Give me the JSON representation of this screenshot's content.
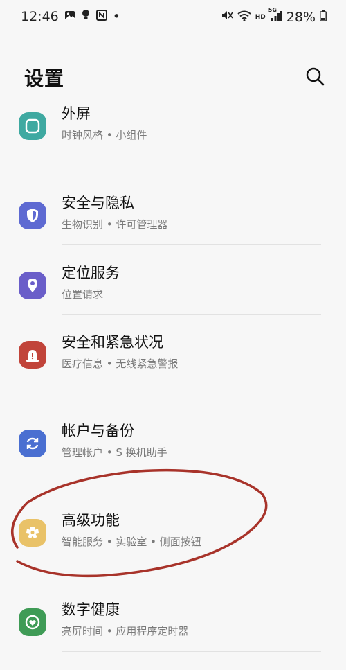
{
  "status_bar": {
    "time": "12:46",
    "dot": "•",
    "network_hd": "HD",
    "network_5g": "5G",
    "battery_percent": "28%"
  },
  "header": {
    "title": "设置"
  },
  "settings_items": [
    {
      "label": "外屏",
      "sub": "时钟风格 • 小组件",
      "icon": "cover-screen-icon",
      "color": "#3fa9a1"
    },
    {
      "label": "安全与隐私",
      "sub": "生物识别 • 许可管理器",
      "icon": "shield-icon",
      "color": "#5e6ad2"
    },
    {
      "label": "定位服务",
      "sub": "位置请求",
      "icon": "location-pin-icon",
      "color": "#6a5ec9"
    },
    {
      "label": "安全和紧急状况",
      "sub": "医疗信息 • 无线紧急警报",
      "icon": "emergency-alert-icon",
      "color": "#c1443a"
    },
    {
      "label": "帐户与备份",
      "sub": "管理帐户 • S 换机助手",
      "icon": "sync-icon",
      "color": "#4a6fd1"
    },
    {
      "label": "高级功能",
      "sub": "智能服务 • 实验室 • 侧面按钮",
      "icon": "advanced-features-icon",
      "color": "#e9c268"
    },
    {
      "label": "数字健康",
      "sub": "亮屏时间 • 应用程序定时器",
      "icon": "digital-wellbeing-icon",
      "color": "#3f9b56"
    }
  ],
  "annotation_color": "#a8332a"
}
